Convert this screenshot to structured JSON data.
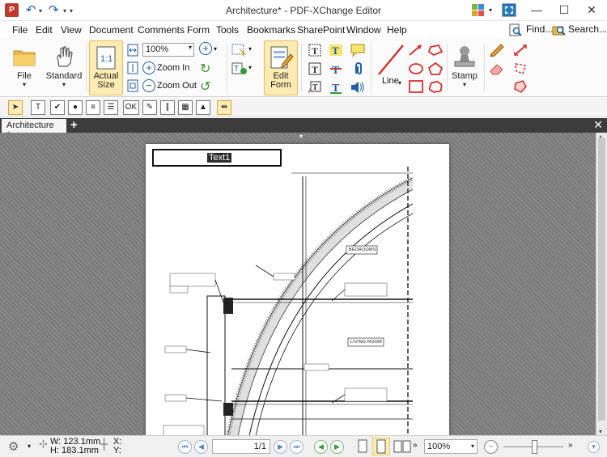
{
  "window": {
    "title": "Architecture* - PDF-XChange Editor"
  },
  "menu": {
    "items": [
      "File",
      "Edit",
      "View",
      "Document",
      "Comments",
      "Form",
      "Tools",
      "Bookmarks",
      "SharePoint",
      "Window",
      "Help"
    ],
    "find_label": "Find...",
    "search_label": "Search..."
  },
  "ribbon": {
    "file_label": "File",
    "standard_label": "Standard",
    "actual_size_label": "Actual Size",
    "zoom_value": "100%",
    "zoom_in_label": "Zoom In",
    "zoom_out_label": "Zoom Out",
    "edit_form_label": "Edit Form",
    "line_label": "Line",
    "stamp_label": "Stamp"
  },
  "tabs": {
    "active_label": "Architecture *"
  },
  "document": {
    "text_field_label": "Text1",
    "room_labels": [
      "BEDROOMS",
      "LIVING ROOM"
    ]
  },
  "status": {
    "width_label": "W: 123.1mm",
    "height_label": "H: 183.1mm",
    "x_label": "X:",
    "y_label": "Y:",
    "page_value": "1/1",
    "zoom_value": "100%"
  },
  "colors": {
    "accent_active": "#fcecb3",
    "title_blue": "#1f5fa8"
  }
}
